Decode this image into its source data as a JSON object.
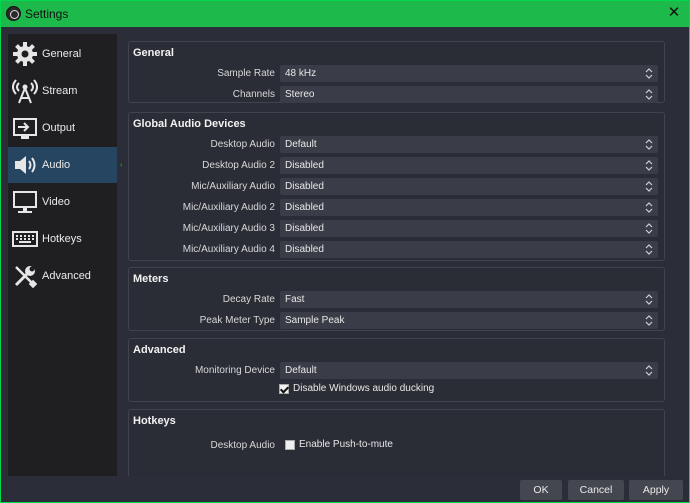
{
  "window": {
    "title": "Settings"
  },
  "sidebar": {
    "items": [
      {
        "label": "General",
        "icon": "gear-icon"
      },
      {
        "label": "Stream",
        "icon": "broadcast-icon"
      },
      {
        "label": "Output",
        "icon": "output-icon"
      },
      {
        "label": "Audio",
        "icon": "speaker-icon",
        "active": true
      },
      {
        "label": "Video",
        "icon": "monitor-icon"
      },
      {
        "label": "Hotkeys",
        "icon": "keyboard-icon"
      },
      {
        "label": "Advanced",
        "icon": "wrench-screwdriver-icon"
      }
    ]
  },
  "colors": {
    "accent": "#1db94a",
    "active_nav": "#264561",
    "arrow": "#22d12e"
  },
  "sections": {
    "general": {
      "title": "General",
      "sample_rate": {
        "label": "Sample Rate",
        "value": "48 kHz"
      },
      "channels": {
        "label": "Channels",
        "value": "Stereo"
      }
    },
    "global_audio": {
      "title": "Global Audio Devices",
      "desktop_audio": {
        "label": "Desktop Audio",
        "value": "Default"
      },
      "desktop_audio_2": {
        "label": "Desktop Audio 2",
        "value": "Disabled"
      },
      "mic_aux": {
        "label": "Mic/Auxiliary Audio",
        "value": "Disabled"
      },
      "mic_aux_2": {
        "label": "Mic/Auxiliary Audio 2",
        "value": "Disabled"
      },
      "mic_aux_3": {
        "label": "Mic/Auxiliary Audio 3",
        "value": "Disabled"
      },
      "mic_aux_4": {
        "label": "Mic/Auxiliary Audio 4",
        "value": "Disabled"
      }
    },
    "meters": {
      "title": "Meters",
      "decay_rate": {
        "label": "Decay Rate",
        "value": "Fast"
      },
      "peak_meter": {
        "label": "Peak Meter Type",
        "value": "Sample Peak"
      }
    },
    "advanced": {
      "title": "Advanced",
      "monitoring": {
        "label": "Monitoring Device",
        "value": "Default"
      },
      "ducking": {
        "label": "Disable Windows audio ducking",
        "checked": true
      }
    },
    "hotkeys": {
      "title": "Hotkeys",
      "desktop_audio": {
        "label": "Desktop Audio"
      },
      "push_to_mute": {
        "label": "Enable Push-to-mute",
        "checked": false
      }
    }
  },
  "buttons": {
    "ok": "OK",
    "cancel": "Cancel",
    "apply": "Apply"
  }
}
